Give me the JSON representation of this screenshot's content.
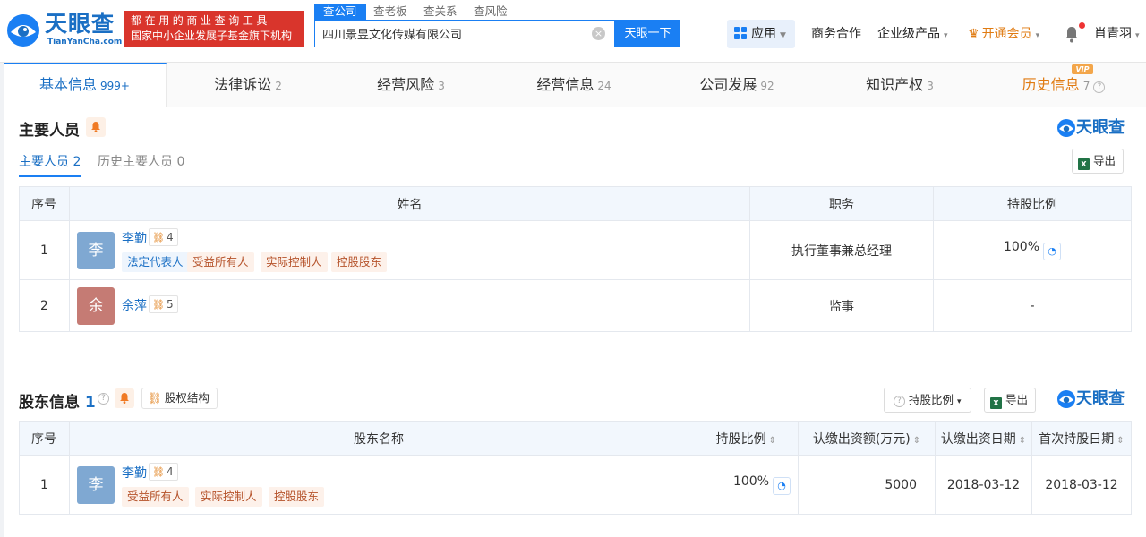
{
  "header": {
    "logo_cn": "天眼查",
    "logo_en": "TianYanCha.com",
    "slogan_line1": "都在用的商业查询工具",
    "slogan_line2": "国家中小企业发展子基金旗下机构",
    "search_tabs": [
      "查公司",
      "查老板",
      "查关系",
      "查风险"
    ],
    "search_value": "四川景昱文化传媒有限公司",
    "search_button": "天眼一下",
    "nav": {
      "app": "应用",
      "business": "商务合作",
      "enterprise": "企业级产品",
      "vip": "开通会员",
      "user": "肖青羽"
    }
  },
  "tabs": [
    {
      "label": "基本信息",
      "count": "999+"
    },
    {
      "label": "法律诉讼",
      "count": "2"
    },
    {
      "label": "经营风险",
      "count": "3"
    },
    {
      "label": "经营信息",
      "count": "24"
    },
    {
      "label": "公司发展",
      "count": "92"
    },
    {
      "label": "知识产权",
      "count": "3"
    },
    {
      "label": "历史信息",
      "count": "7"
    }
  ],
  "vip_badge": "VIP",
  "brand": "天眼查",
  "key_personnel": {
    "title": "主要人员",
    "subtab_current": "主要人员",
    "subtab_current_count": "2",
    "subtab_history": "历史主要人员",
    "subtab_history_count": "0",
    "export": "导出",
    "columns": [
      "序号",
      "姓名",
      "职务",
      "持股比例"
    ],
    "rows": [
      {
        "no": "1",
        "avatar": "李",
        "name": "李勤",
        "rel": "4",
        "tags": [
          "法定代表人",
          "受益所有人",
          "实际控制人",
          "控股股东"
        ],
        "position": "执行董事兼总经理",
        "ratio": "100%"
      },
      {
        "no": "2",
        "avatar": "余",
        "name": "余萍",
        "rel": "5",
        "tags": [],
        "position": "监事",
        "ratio": "-"
      }
    ]
  },
  "shareholders": {
    "title": "股东信息",
    "count": "1",
    "structure_button": "股权结构",
    "ratio_dropdown": "持股比例",
    "export": "导出",
    "columns": [
      "序号",
      "股东名称",
      "持股比例",
      "认缴出资额(万元)",
      "认缴出资日期",
      "首次持股日期"
    ],
    "rows": [
      {
        "no": "1",
        "avatar": "李",
        "name": "李勤",
        "rel": "4",
        "tags": [
          "受益所有人",
          "实际控制人",
          "控股股东"
        ],
        "ratio": "100%",
        "amount": "5000",
        "date": "2018-03-12",
        "first_date": "2018-03-12"
      }
    ]
  },
  "colors": {
    "brand_blue": "#1a7ff3",
    "accent_orange": "#e07b12",
    "slogan_red": "#d9352c"
  }
}
